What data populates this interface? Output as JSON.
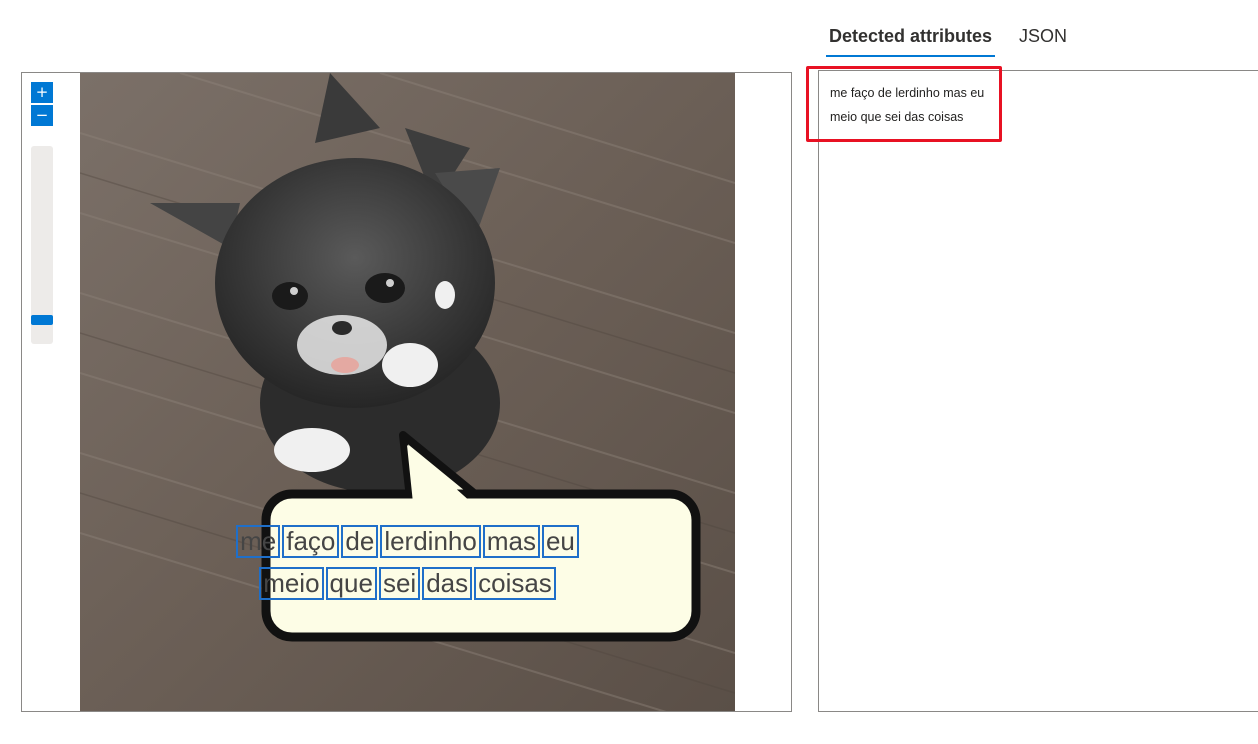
{
  "tabs": [
    {
      "label": "Detected attributes",
      "active": true
    },
    {
      "label": "JSON",
      "active": false
    }
  ],
  "viewer": {
    "zoom_in_label": "+",
    "zoom_out_label": "−",
    "zoom_level": 0.9
  },
  "ocr": {
    "lines": [
      {
        "words": [
          "me",
          "faço",
          "de",
          "lerdinho",
          "mas",
          "eu"
        ]
      },
      {
        "words": [
          "meio",
          "que",
          "sei",
          "das",
          "coisas"
        ]
      }
    ]
  },
  "result": {
    "lines": [
      "me faço de lerdinho mas eu",
      "meio que sei das coisas"
    ]
  },
  "colors": {
    "accent": "#0078d4",
    "ocr_box": "#1f6fc9",
    "highlight": "#e81123"
  }
}
